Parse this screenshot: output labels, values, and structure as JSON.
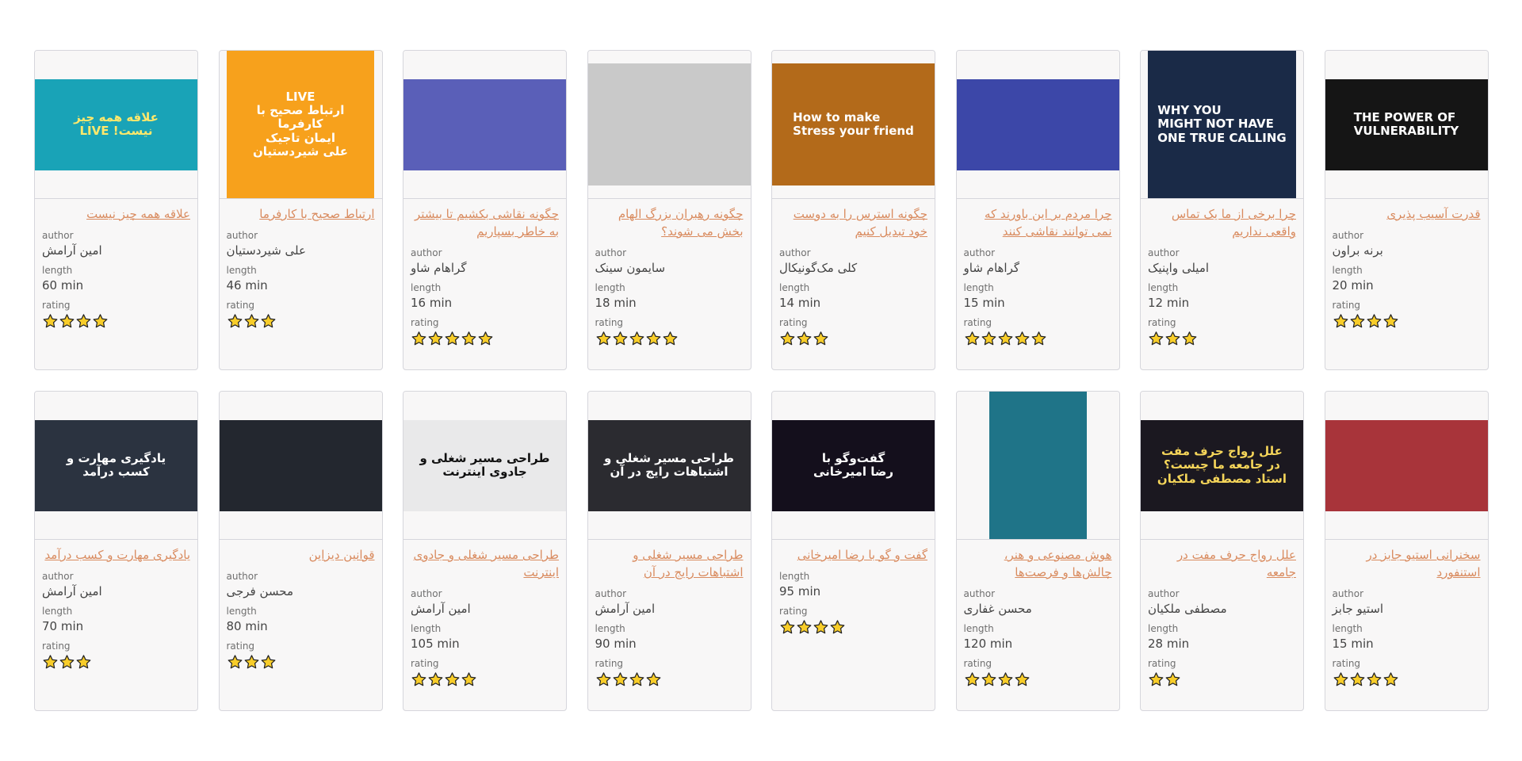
{
  "labels": {
    "author": "author",
    "length": "length",
    "rating": "rating"
  },
  "colors": {
    "link": "#d98b5f",
    "card_bg": "#f8f7f7",
    "border": "#d6d6dc",
    "star_fill": "#f8cd2a",
    "star_stroke": "#222222"
  },
  "cards": [
    {
      "title": "علاقه همه چیز نیست",
      "author": "امین آرامش",
      "length": "60 min",
      "rating": 4,
      "thumb": {
        "kind": "wide",
        "bg": "#19a3b7",
        "text": "علاقه همه چیز\nنیست!  LIVE",
        "fg": "#ffe86b",
        "dir": "rtl"
      }
    },
    {
      "title": "ارتباط صحیح با کارفرما",
      "author": "علی شیردستیان",
      "length": "46 min",
      "rating": 3,
      "thumb": {
        "kind": "tall",
        "bg": "#f7a11c",
        "text": "LIVE\nارتباط صحیح با کارفرما\nایمان تاجیک\nعلی شیردستیان",
        "fg": "#ffffff",
        "dir": "rtl"
      }
    },
    {
      "title": "چگونه نقاشی بکشیم تا بیشتر به خاطر بسپاریم",
      "author": "گراهام شاو",
      "length": "16 min",
      "rating": 5,
      "thumb": {
        "kind": "wide",
        "bg": "#5a5fb8",
        "text": "",
        "fg": "#ffffff",
        "dir": "ltr"
      }
    },
    {
      "title": "چگونه رهبران بزرگ الهام بخش می شوند؟",
      "author": "سایمون سینک",
      "length": "18 min",
      "rating": 5,
      "thumb": {
        "kind": "wide-tall",
        "bg": "#c9c9c9",
        "text": "",
        "fg": "#222222",
        "dir": "ltr"
      }
    },
    {
      "title": "چگونه استرس را به دوست خود تبدیل کنیم",
      "author": "کلی مک‌گونیکال",
      "length": "14 min",
      "rating": 3,
      "thumb": {
        "kind": "wide-tall",
        "bg": "#b36a1a",
        "text": "How to make\nStress your friend",
        "fg": "#ffffff",
        "dir": "ltr"
      }
    },
    {
      "title": "چرا مردم بر این باورند که نمی توانند نقاشی کنند",
      "author": "گراهام شاو",
      "length": "15 min",
      "rating": 5,
      "thumb": {
        "kind": "wide",
        "bg": "#3c47a8",
        "text": "",
        "fg": "#ffffff",
        "dir": "ltr"
      }
    },
    {
      "title": "چرا برخی از ما یک تماس واقعی نداریم",
      "author": "امیلی واپنیک",
      "length": "12 min",
      "rating": 3,
      "thumb": {
        "kind": "tall-inset",
        "bg": "#1a2a47",
        "text": "WHY YOU\nMIGHT NOT HAVE\nONE TRUE CALLING",
        "fg": "#ffffff",
        "dir": "ltr"
      }
    },
    {
      "title": "قدرت آسیب پذیری",
      "author": "برنه براون",
      "length": "20 min",
      "rating": 4,
      "thumb": {
        "kind": "wide",
        "bg": "#151515",
        "text": "THE POWER OF\nVULNERABILITY",
        "fg": "#ffffff",
        "dir": "ltr"
      }
    },
    {
      "title": "یادگیری مهارت و کسب درآمد",
      "author": "امین آرامش",
      "length": "70 min",
      "rating": 3,
      "thumb": {
        "kind": "wide",
        "bg": "#2b3340",
        "text": "یادگیری مهارت و\nکسب درآمد",
        "fg": "#ffffff",
        "dir": "rtl"
      }
    },
    {
      "title": "قوانین دیزاین",
      "author": "محسن فرجی",
      "length": "80 min",
      "rating": 3,
      "thumb": {
        "kind": "wide",
        "bg": "#23272f",
        "text": "",
        "fg": "#ffffff",
        "dir": "ltr"
      }
    },
    {
      "title": "طراحی مسیر شغلی و جادوی اینترنت",
      "author": "امین آرامش",
      "length": "105 min",
      "rating": 4,
      "thumb": {
        "kind": "wide",
        "bg": "#e9e9ea",
        "text": "طراحی مسیر شغلی و\nجادوی اینترنت",
        "fg": "#111111",
        "dir": "rtl"
      }
    },
    {
      "title": "طراحی مسیر شغلی و اشتباهات رایج در آن",
      "author": "امین آرامش",
      "length": "90 min",
      "rating": 4,
      "thumb": {
        "kind": "wide",
        "bg": "#2b2b30",
        "text": "طراحی مسیر شغلی و\nاشتباهات رایج در آن",
        "fg": "#ffffff",
        "dir": "rtl"
      }
    },
    {
      "title": "گفت و گو با رضا امیرخانی",
      "author": "",
      "length": "95 min",
      "rating": 4,
      "thumb": {
        "kind": "wide",
        "bg": "#140f1c",
        "text": "گفت‌وگو با\nرضا امیرخانی",
        "fg": "#ffffff",
        "dir": "rtl"
      }
    },
    {
      "title": "هوش مصنوعی و هنر، چالش‌ها و فرصت‌ها",
      "author": "محسن غفاری",
      "length": "120 min",
      "rating": 4,
      "thumb": {
        "kind": "poster",
        "bg": "#1f7488",
        "text": "",
        "fg": "#ffffff",
        "dir": "rtl"
      }
    },
    {
      "title": "علل رواج حرف مفت در جامعه",
      "author": "مصطفی ملکیان",
      "length": "28 min",
      "rating": 2,
      "thumb": {
        "kind": "wide",
        "bg": "#1b1820",
        "text": "علل رواج حرف مفت\nدر جامعه ما چیست؟\nاستاد مصطفی ملکیان",
        "fg": "#f5d55a",
        "dir": "rtl"
      }
    },
    {
      "title": "سخنرانی استیو جابز در استنفورد",
      "author": "استیو جابز",
      "length": "15 min",
      "rating": 4,
      "thumb": {
        "kind": "wide",
        "bg": "#a8343a",
        "text": "",
        "fg": "#ffffff",
        "dir": "ltr"
      }
    }
  ]
}
